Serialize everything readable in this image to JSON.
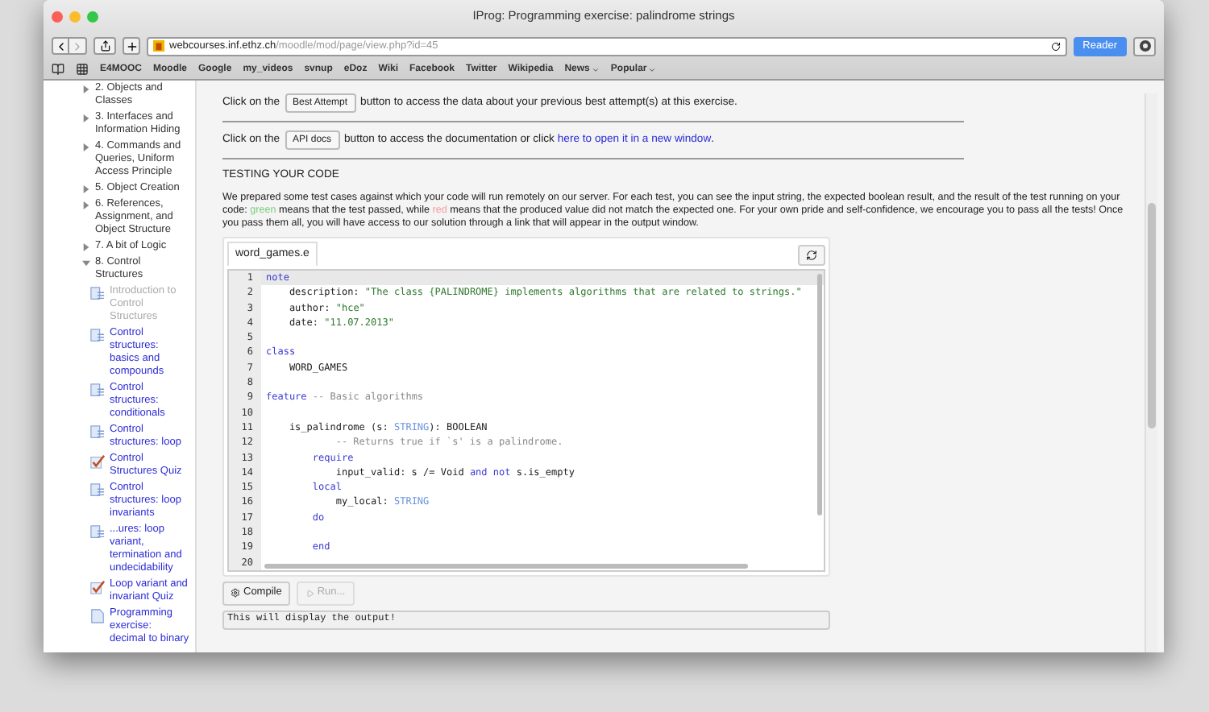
{
  "window": {
    "title": "IProg: Programming exercise: palindrome strings"
  },
  "toolbar": {
    "url_host": "webcourses.inf.ethz.ch",
    "url_path": "/moodle/mod/page/view.php?id=45",
    "reader": "Reader"
  },
  "bookmarks": [
    {
      "label": "E4MOOC",
      "menu": false
    },
    {
      "label": "Moodle",
      "menu": false
    },
    {
      "label": "Google",
      "menu": false
    },
    {
      "label": "my_videos",
      "menu": false
    },
    {
      "label": "svnup",
      "menu": false
    },
    {
      "label": "eDoz",
      "menu": false
    },
    {
      "label": "Wiki",
      "menu": false
    },
    {
      "label": "Facebook",
      "menu": false
    },
    {
      "label": "Twitter",
      "menu": false
    },
    {
      "label": "Wikipedia",
      "menu": false
    },
    {
      "label": "News",
      "menu": true
    },
    {
      "label": "Popular",
      "menu": true
    }
  ],
  "sidebar": {
    "items": [
      {
        "label": "2. Objects and Classes",
        "expanded": false
      },
      {
        "label": "3. Interfaces and Information Hiding",
        "expanded": false
      },
      {
        "label": "4. Commands and Queries, Uniform Access Principle",
        "expanded": false
      },
      {
        "label": "5. Object Creation",
        "expanded": false
      },
      {
        "label": "6. References, Assignment, and Object Structure",
        "expanded": false
      },
      {
        "label": "7. A bit of Logic",
        "expanded": false
      },
      {
        "label": "8. Control Structures",
        "expanded": true,
        "children": [
          {
            "label": "Introduction to Control Structures",
            "kind": "page",
            "disabled": true
          },
          {
            "label": "Control structures: basics and compounds",
            "kind": "page",
            "disabled": false
          },
          {
            "label": "Control structures: conditionals",
            "kind": "page",
            "disabled": false
          },
          {
            "label": "Control structures: loop",
            "kind": "page",
            "disabled": false
          },
          {
            "label": "Control Structures Quiz",
            "kind": "quiz",
            "disabled": false
          },
          {
            "label": "Control structures: loop invariants",
            "kind": "page",
            "disabled": false
          },
          {
            "label": "...ures: loop variant, termination and undecidability",
            "kind": "page",
            "disabled": false
          },
          {
            "label": "Loop variant and invariant Quiz",
            "kind": "quiz",
            "disabled": false
          },
          {
            "label": "Programming exercise: decimal to binary",
            "kind": "assignment",
            "disabled": false
          }
        ]
      }
    ]
  },
  "content": {
    "best_attempt": {
      "before": "Click on the",
      "button": "Best Attempt",
      "after": "button to access the data about your previous best attempt(s) at this exercise."
    },
    "api_docs": {
      "before": "Click on the",
      "button": "API docs",
      "middle": "button to access the documentation or click",
      "link": "here to open it in a new window",
      "after": "."
    },
    "heading": "TESTING YOUR CODE",
    "description": [
      {
        "text": "We prepared some test cases against which your code will run remotely on our server. For each test, you can see the input string, the expected boolean result, and the result of the test running on your code: "
      },
      {
        "text": "green",
        "color": "#7ccf7c"
      },
      {
        "text": " means that the test passed, while "
      },
      {
        "text": "red",
        "color": "#f0a0a0"
      },
      {
        "text": " means that the produced value did not match the expected one. For your own pride and self-confidence, we encourage you to pass all the tests! Once you pass them all, you will have access to our solution through a link that will appear in the output window."
      }
    ],
    "editor": {
      "tab": "word_games.e",
      "lines": [
        {
          "number": "1",
          "current": true,
          "segments": [
            {
              "text": "note",
              "kind": "keyword"
            }
          ]
        },
        {
          "number": "2",
          "current": false,
          "segments": [
            {
              "text": "    description: ",
              "kind": "plain"
            },
            {
              "text": "\"The class {PALINDROME} implements algorithms that are related to strings.\"",
              "kind": "string"
            }
          ]
        },
        {
          "number": "3",
          "current": false,
          "segments": [
            {
              "text": "    author: ",
              "kind": "plain"
            },
            {
              "text": "\"hce\"",
              "kind": "string"
            }
          ]
        },
        {
          "number": "4",
          "current": false,
          "segments": [
            {
              "text": "    date: ",
              "kind": "plain"
            },
            {
              "text": "\"11.07.2013\"",
              "kind": "string"
            }
          ]
        },
        {
          "number": "5",
          "current": false
        },
        {
          "number": "6",
          "current": false,
          "segments": [
            {
              "text": "class",
              "kind": "keyword"
            }
          ]
        },
        {
          "number": "7",
          "current": false,
          "segments": [
            {
              "text": "    WORD_GAMES",
              "kind": "plain"
            }
          ]
        },
        {
          "number": "8",
          "current": false
        },
        {
          "number": "9",
          "current": false,
          "segments": [
            {
              "text": "feature",
              "kind": "keyword"
            },
            {
              "text": " -- Basic algorithms",
              "kind": "comment"
            }
          ]
        },
        {
          "number": "10",
          "current": false
        },
        {
          "number": "11",
          "current": false,
          "segments": [
            {
              "text": "    is_palindrome (s: ",
              "kind": "plain"
            },
            {
              "text": "STRING",
              "kind": "type"
            },
            {
              "text": "): BOOLEAN",
              "kind": "plain"
            }
          ]
        },
        {
          "number": "12",
          "current": false,
          "segments": [
            {
              "text": "            -- Returns true if `s' is a palindrome.",
              "kind": "comment"
            }
          ]
        },
        {
          "number": "13",
          "current": false,
          "segments": [
            {
              "text": "        require",
              "kind": "keyword"
            }
          ]
        },
        {
          "number": "14",
          "current": false,
          "segments": [
            {
              "text": "            input_valid: s /= Void ",
              "kind": "plain"
            },
            {
              "text": "and not",
              "kind": "keyword"
            },
            {
              "text": " s.is_empty",
              "kind": "plain"
            }
          ]
        },
        {
          "number": "15",
          "current": false,
          "segments": [
            {
              "text": "        local",
              "kind": "keyword"
            }
          ]
        },
        {
          "number": "16",
          "current": false,
          "segments": [
            {
              "text": "            my_local: ",
              "kind": "plain"
            },
            {
              "text": "STRING",
              "kind": "type"
            }
          ]
        },
        {
          "number": "17",
          "current": false,
          "segments": [
            {
              "text": "        do",
              "kind": "keyword"
            }
          ]
        },
        {
          "number": "18",
          "current": false
        },
        {
          "number": "19",
          "current": false,
          "segments": [
            {
              "text": "        end",
              "kind": "keyword"
            }
          ]
        },
        {
          "number": "20",
          "current": false
        }
      ]
    },
    "compile": {
      "label": "Compile",
      "disabled": false
    },
    "run": {
      "label": "Run...",
      "disabled": true
    },
    "output": "This will display the output!"
  }
}
